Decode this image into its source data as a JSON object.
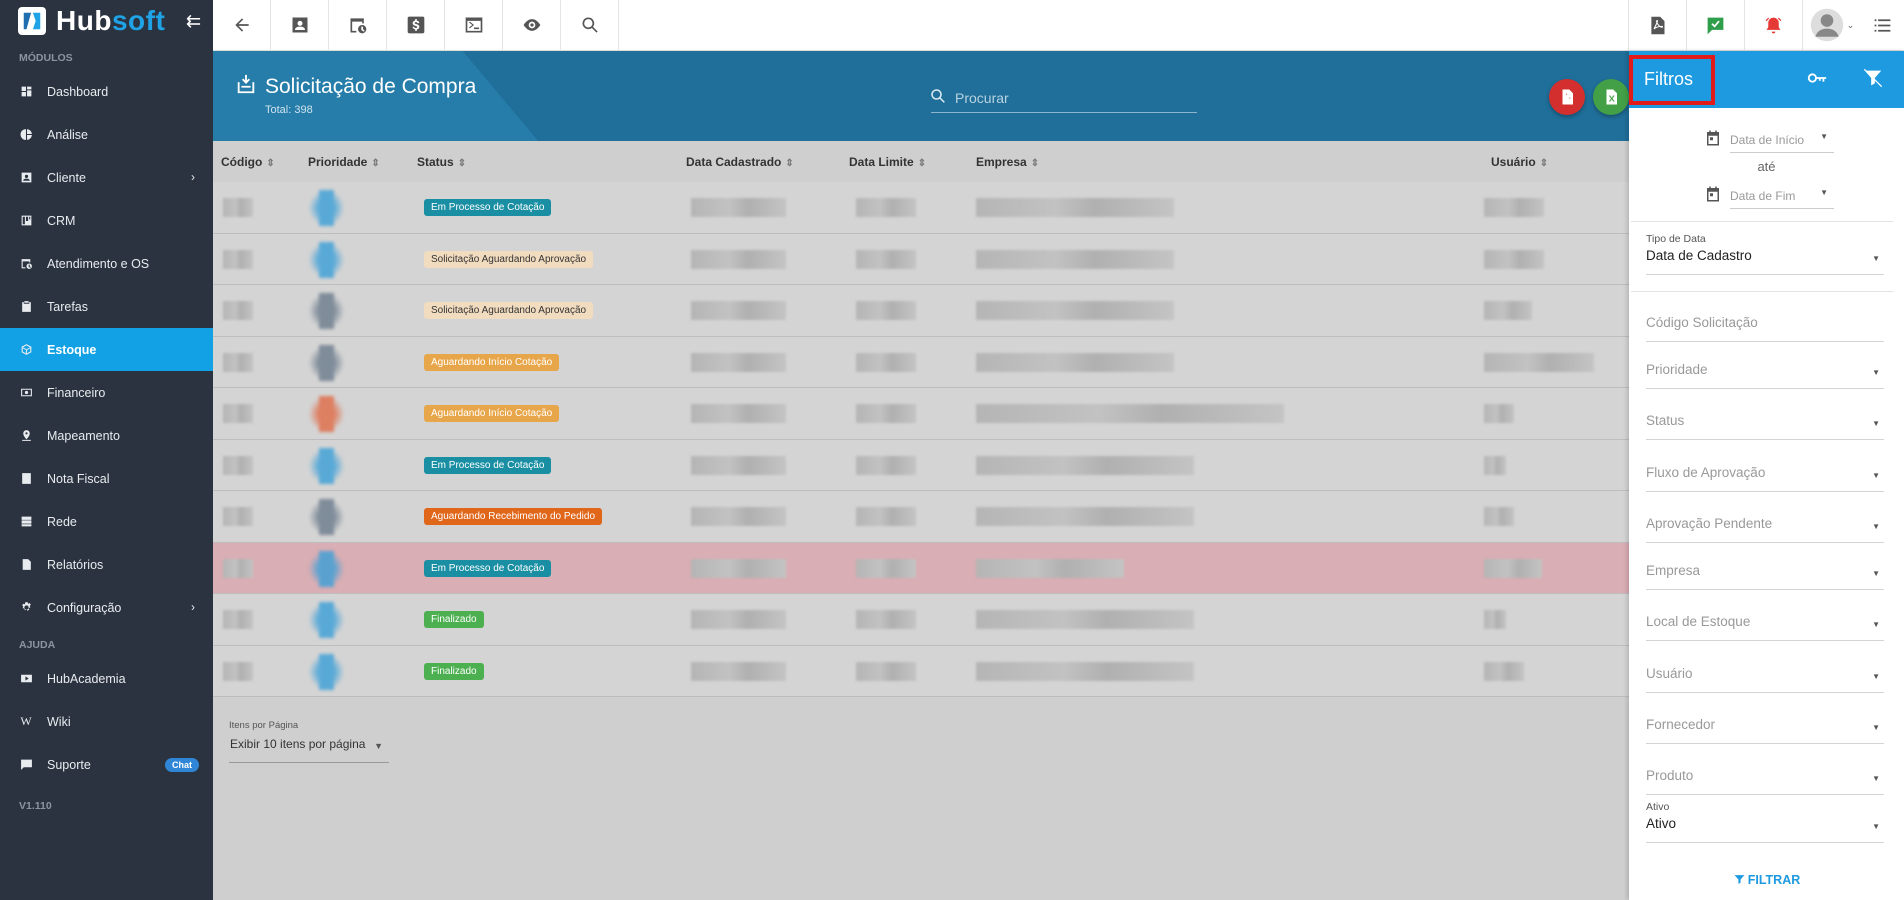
{
  "sidebar": {
    "logo_hub": "Hub",
    "logo_soft": "soft",
    "section_modulos": "MÓDULOS",
    "section_ajuda": "AJUDA",
    "items": [
      {
        "label": "Dashboard",
        "icon": "dashboard-icon"
      },
      {
        "label": "Análise",
        "icon": "pie-chart-icon"
      },
      {
        "label": "Cliente",
        "icon": "contact-card-icon"
      },
      {
        "label": "CRM",
        "icon": "kanban-icon"
      },
      {
        "label": "Atendimento e OS",
        "icon": "calendar-clock-icon"
      },
      {
        "label": "Tarefas",
        "icon": "clipboard-icon"
      },
      {
        "label": "Estoque",
        "icon": "cube-icon"
      },
      {
        "label": "Financeiro",
        "icon": "money-icon"
      },
      {
        "label": "Mapeamento",
        "icon": "map-pin-icon"
      },
      {
        "label": "Nota Fiscal",
        "icon": "receipt-icon"
      },
      {
        "label": "Rede",
        "icon": "server-icon"
      },
      {
        "label": "Relatórios",
        "icon": "document-icon"
      },
      {
        "label": "Configuração",
        "icon": "gear-icon"
      }
    ],
    "help_items": [
      {
        "label": "HubAcademia",
        "icon": "youtube-icon"
      },
      {
        "label": "Wiki",
        "icon": "wiki-icon"
      },
      {
        "label": "Suporte",
        "icon": "chat-icon",
        "badge": "Chat"
      }
    ],
    "version": "V1.110"
  },
  "page": {
    "title": "Solicitação de Compra",
    "total": "Total: 398",
    "search_placeholder": "Procurar"
  },
  "table": {
    "columns": [
      "Código",
      "Prioridade",
      "Status",
      "Data Cadastrado",
      "Data Limite",
      "Empresa",
      "Usuário"
    ],
    "rows": [
      {
        "status": "Em Processo de Cotação",
        "status_color": "#1a8fa3",
        "prio_color": "#3b9fd8"
      },
      {
        "status": "Solicitação Aguardando Aprovação",
        "status_color": "#f2dcc0",
        "prio_color": "#3b9fd8"
      },
      {
        "status": "Solicitação Aguardando Aprovação",
        "status_color": "#f2dcc0",
        "prio_color": "#6b7b8c"
      },
      {
        "status": "Aguardando Início Cotação",
        "status_color": "#e8a64a",
        "prio_color": "#6b7b8c"
      },
      {
        "status": "Aguardando Início Cotação",
        "status_color": "#e8a64a",
        "prio_color": "#e06a45"
      },
      {
        "status": "Em Processo de Cotação",
        "status_color": "#1a8fa3",
        "prio_color": "#3b9fd8"
      },
      {
        "status": "Aguardando Recebimento do Pedido",
        "status_color": "#e0661a",
        "prio_color": "#6b7b8c"
      },
      {
        "status": "Em Processo de Cotação",
        "status_color": "#1a8fa3",
        "prio_color": "#3b9fd8"
      },
      {
        "status": "Finalizado",
        "status_color": "#4caf50",
        "prio_color": "#3b9fd8"
      },
      {
        "status": "Finalizado",
        "status_color": "#4caf50",
        "prio_color": "#3b9fd8"
      }
    ],
    "highlighted_row": 7
  },
  "pager": {
    "label": "Itens por Página",
    "value": "Exibir 10 itens por página"
  },
  "filters": {
    "title": "Filtros",
    "date_start": "Data de Início",
    "until": "até",
    "date_end": "Data de Fim",
    "date_type_label": "Tipo de Data",
    "date_type_value": "Data de Cadastro",
    "codigo": "Código Solicitação",
    "prioridade": "Prioridade",
    "status": "Status",
    "fluxo": "Fluxo de Aprovação",
    "aprovacao": "Aprovação Pendente",
    "empresa": "Empresa",
    "local": "Local de Estoque",
    "usuario": "Usuário",
    "fornecedor": "Fornecedor",
    "produto": "Produto",
    "ativo_label": "Ativo",
    "ativo_value": "Ativo",
    "filter_button": "FILTRAR"
  },
  "colors": {
    "sidebar_bg": "#2b3340",
    "accent": "#13a1e5",
    "header_bg": "#1f6f9a"
  }
}
